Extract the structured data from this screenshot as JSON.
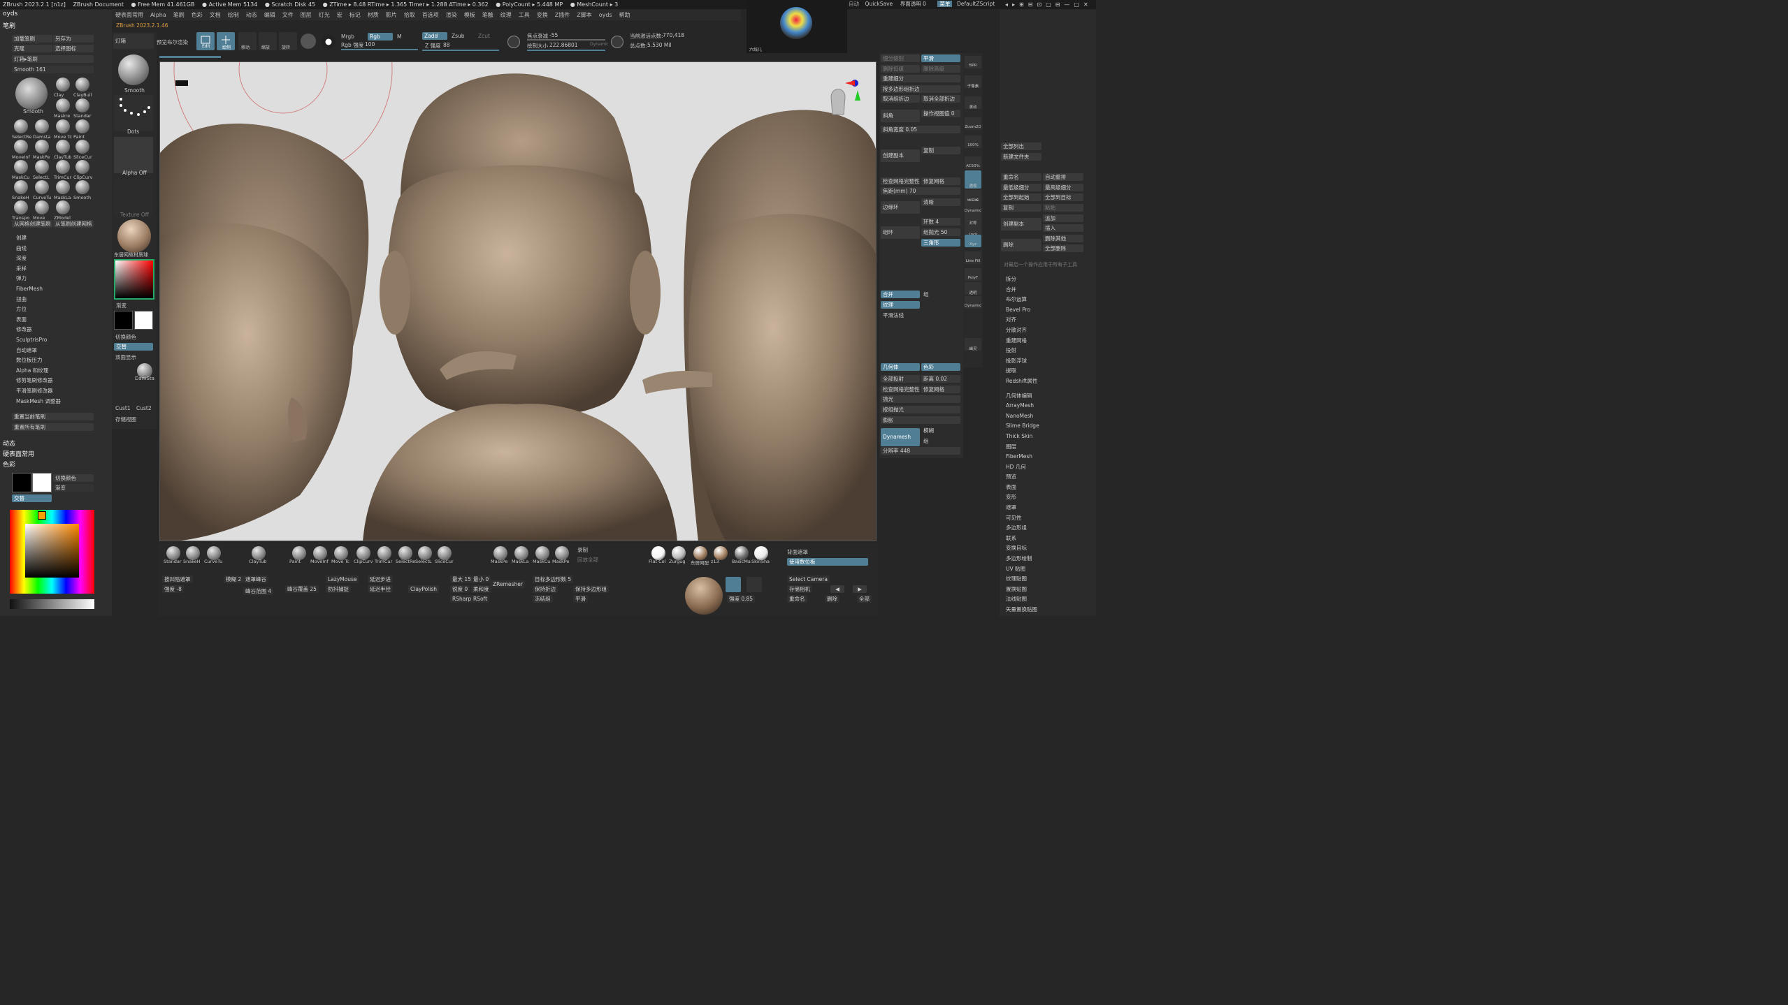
{
  "topbar": {
    "items": [
      "ZBrush 2023.2.1 [n1z]",
      "ZBrush Document",
      "● Free Mem 41.461GB",
      "● Active Mem 5134",
      "● Scratch Disk 45",
      "● ZTime ▸ 8.48 RTime ▸ 1.365 Timer ▸ 1.288 ATime ▸ 0.362",
      "● PolyCount ▸ 5.448 MP",
      "● MeshCount ▸ 3"
    ],
    "right": [
      "自动",
      "QuickSave",
      "界面透明 0",
      "菜单",
      "DefaultZScript"
    ]
  },
  "menubar": [
    "硬表面常用",
    "Alpha",
    "笔刷",
    "色彩",
    "文档",
    "绘制",
    "动态",
    "编辑",
    "文件",
    "图层",
    "灯光",
    "宏",
    "标记",
    "材质",
    "影片",
    "拾取",
    "首选项",
    "渲染",
    "模板",
    "笔触",
    "纹理",
    "工具",
    "变换",
    "Z插件",
    "Z脚本",
    "oyds",
    "帮助"
  ],
  "version_label": "ZBrush 2023.2.1.46",
  "left": {
    "title": "oyds",
    "brush_header": "笔刷",
    "buttons": [
      "加载笔刷",
      "另存为",
      "克隆",
      "选择图标",
      "灯箱▸笔刷"
    ],
    "smooth_label": "Smooth",
    "smooth_value": "161",
    "brush_names": [
      "Smooth",
      "Clay",
      "ClayBuil",
      "Maskre",
      "Standar",
      "SelectRe",
      "Damsta",
      "Move Tc",
      "Paint",
      "MoveInf",
      "MaskPe",
      "ClayTub",
      "SliceCur",
      "MaskCu",
      "SelectL",
      "TrimCur",
      "ClipCurv",
      "SnakeH",
      "CurveTu",
      "MaskLa",
      "Smooth",
      "Transpo",
      "Move",
      "ZModel"
    ],
    "mesh_buttons": [
      "从网格创建笔刷",
      "从笔刷创建网格"
    ],
    "menu_items": [
      "创建",
      "曲线",
      "深度",
      "采样",
      "弹力",
      "FiberMesh",
      "扭曲",
      "方位",
      "表面",
      "修改器",
      "SculptrisPro",
      "自动遮罩",
      "数位板压力",
      "Alpha 和纹理",
      "修剪笔刷修改器",
      "平滑笔刷修改器",
      "MaskMesh 调整器"
    ],
    "reset_buttons": [
      "重置当前笔刷",
      "重置所有笔刷"
    ],
    "sections": [
      "动态",
      "硬表面常用",
      "色彩"
    ],
    "color_buttons": [
      "切换颜色",
      "渐变",
      "交替"
    ]
  },
  "leftmid": {
    "items": [
      "灯箱",
      "预览布尔渲染",
      "Smooth",
      "Dots",
      "Alpha Off",
      "Texture Off",
      "东居网故材质球",
      "渐变",
      "切换颜色",
      "交替",
      "双面显示",
      "DamSta",
      "Cust1",
      "Cust2",
      "存储视图"
    ]
  },
  "toolbar": {
    "edit": "Edit",
    "draw": "绘制",
    "mrgb": "Mrgb",
    "rgb": "Rgb",
    "m": "M",
    "zadd": "Zadd",
    "zsub": "Zsub",
    "zcut": "Zcut",
    "rgb_intensity_label": "Rgb 强度",
    "rgb_intensity": "100",
    "z_intensity_label": "Z 强度",
    "z_intensity": "88",
    "focal_label": "焦点衰减",
    "focal_value": "-55",
    "draw_size_label": "绘制大小",
    "draw_size_value": "222.86801",
    "dynamic": "Dynamic",
    "active_points_label": "当前激活点数:",
    "active_points": "770,418",
    "total_points_label": "总点数:",
    "total_points": "5.530 Mil",
    "tool_icons": [
      "移动",
      "缩放",
      "旋转"
    ],
    "mirror_label": "六线儿"
  },
  "right": {
    "items": [
      "细分级别",
      "平滑",
      "删除低级",
      "删除高级",
      "重建细分",
      "按多边形组折边",
      "取消组折边",
      "取消全部折边",
      "斜角",
      "操作视图值 0",
      "斜角宽度 0.05",
      "创建副本",
      "复制",
      "检查网格完整性",
      "修复网格",
      "焦距(mm) 70",
      "边缘环",
      "清晰",
      "组环",
      "环数 4",
      "组抛光 50",
      "三角形",
      "合并",
      "组",
      "纹理",
      "平滑法线",
      "几何体",
      "色彩",
      "全部投射",
      "距离 0.02",
      "检查网格完整性",
      "修复网格",
      "抛光",
      "按组抛光",
      "膨胀",
      "Dynamesh",
      "组",
      "模糊",
      "分辨率 448"
    ]
  },
  "righttools": [
    "BPR",
    "子像素",
    "滚动",
    "Zoom2D",
    "100%",
    "AC50%",
    "透视",
    "地网格",
    "Dynamic",
    "对称",
    "Lock",
    "Xyz",
    "Line Fill",
    "PolyF",
    "透明",
    "Dynamic",
    "幽灵"
  ],
  "farright": {
    "top_buttons": [
      "全部列出",
      "新建文件夹",
      "重命名",
      "自动重排",
      "最低级细分",
      "最高级细分",
      "全部到起始",
      "全部到目标",
      "复制",
      "粘贴",
      "创建副本",
      "追加",
      "插入",
      "删除",
      "删除其他",
      "全部删除"
    ],
    "note": "对最后一个操作应用于所有子工具",
    "items": [
      "拆分",
      "合并",
      "布尔运算",
      "Bevel Pro",
      "对齐",
      "分散对齐",
      "重建网格",
      "投射",
      "投影浮球",
      "提取",
      "Redshift属性",
      "几何体编辑",
      "ArrayMesh",
      "NanoMesh",
      "Slime Bridge",
      "Thick Skin",
      "图层",
      "FiberMesh",
      "HD 几何",
      "预览",
      "表面",
      "变形",
      "遮罩",
      "可见性",
      "多边形组",
      "联系",
      "变换目标",
      "多边形绘制",
      "UV 贴图",
      "纹理贴图",
      "置换贴图",
      "法线贴图",
      "矢量置换贴图"
    ]
  },
  "bottom": {
    "brushes": [
      "Standar",
      "SnakeH",
      "CurveTu",
      "ClayTub",
      "Paint",
      "MoveInf",
      "Move Tc",
      "ClipCurv",
      "TrimCur",
      "SelectRe",
      "SelectL",
      "SliceCur",
      "MaskPe",
      "MaskLa",
      "MaskCu",
      "MaskPe"
    ],
    "record": "录制",
    "playback": "回放全部",
    "materials": [
      "Flat Col",
      "Zurgug",
      "东居网配",
      "z13",
      "BasicMa",
      "SkinSha"
    ],
    "backface_mask": "背面遮罩",
    "use_position": "使用数位板",
    "controls": [
      "按凹陷遮罩",
      "模糊 2",
      "遮罩峰谷",
      "LazyMouse",
      "延迟步进",
      "强度 -8",
      "峰谷范围 4",
      "峰谷覆盖 25",
      "防抖捕捉",
      "延迟半径",
      "ClayPolish",
      "最大 15",
      "最小 0",
      "锐度 0",
      "柔和度",
      "RSharp",
      "RSoft",
      "ZRemesher",
      "目标多边形数 5",
      "保持折边",
      "保持多边形组",
      "冻结组",
      "平滑",
      "Select Camera",
      "存储相机",
      "重命名",
      "删除",
      "全部",
      "强度 0.85"
    ]
  },
  "colors": {
    "accent": "#4f7e95",
    "viewport_bg": "#dedede",
    "clay": "#9a8571"
  }
}
